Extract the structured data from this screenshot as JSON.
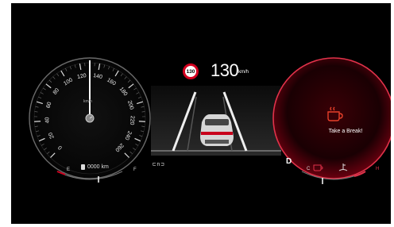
{
  "speed_limit": "130",
  "current_speed": "130",
  "speed_unit": "km/h",
  "speedo_ticks": [
    "0",
    "20",
    "40",
    "60",
    "80",
    "100",
    "120",
    "140",
    "160",
    "180",
    "200",
    "220",
    "240",
    "260"
  ],
  "speedo_unit": "km/h",
  "odometer": "0000 km",
  "fuel_empty": "E",
  "fuel_full": "F",
  "gear": "D",
  "drive_indicator": "⊏n⊐",
  "alert_message": "Take a Break!",
  "temp_cold": "C",
  "temp_hot": "H",
  "colors": {
    "accent_red": "#d3001f",
    "gauge_red": "#e0324a",
    "background": "#000000"
  }
}
